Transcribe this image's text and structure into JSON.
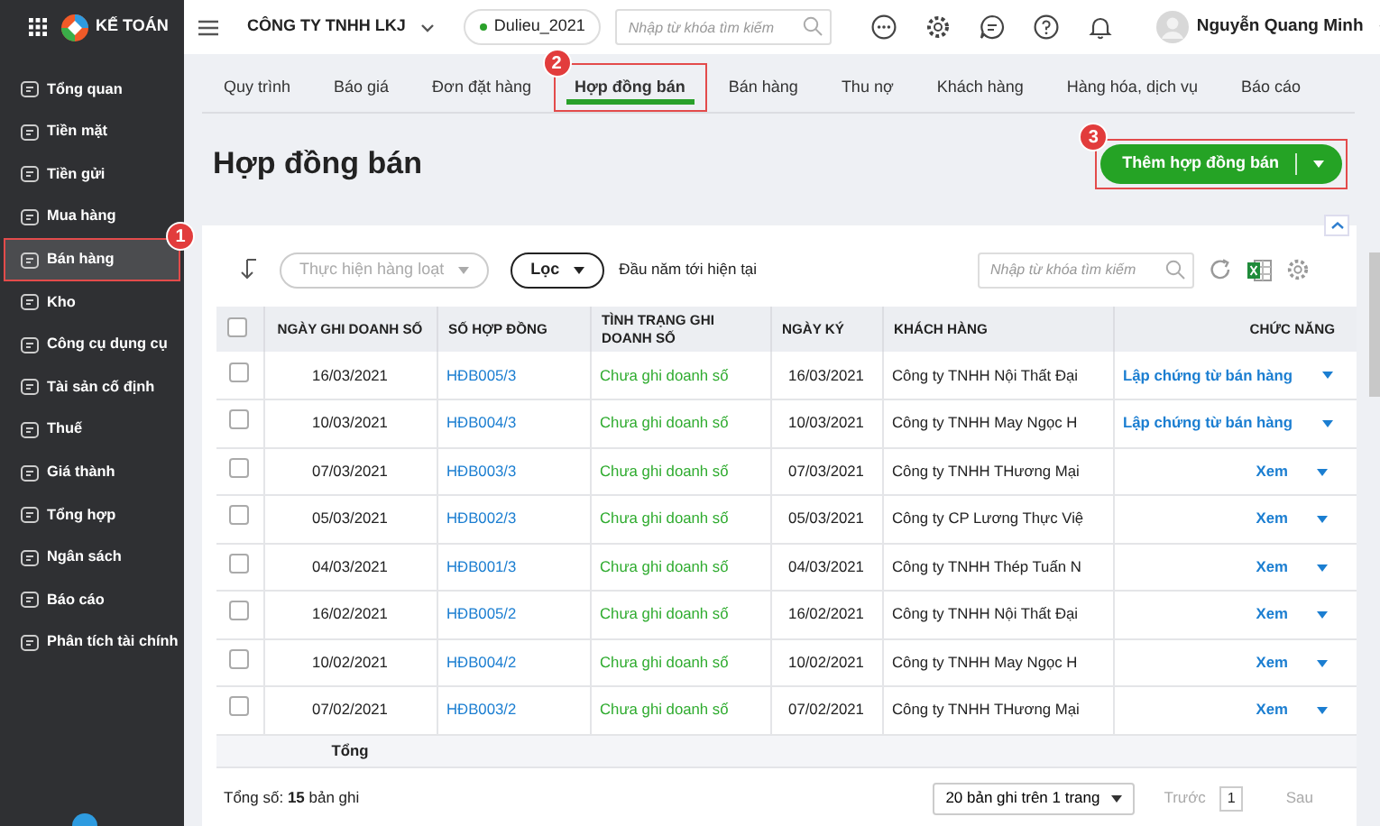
{
  "app": {
    "name": "KẾ TOÁN"
  },
  "header": {
    "company": "CÔNG TY TNHH LKJ",
    "database": "Dulieu_2021",
    "search_placeholder": "Nhập từ khóa tìm kiếm",
    "user": "Nguyễn Quang Minh"
  },
  "sidebar": {
    "items": [
      {
        "label": "Tổng quan",
        "selected": false
      },
      {
        "label": "Tiền mặt",
        "selected": false
      },
      {
        "label": "Tiền gửi",
        "selected": false
      },
      {
        "label": "Mua hàng",
        "selected": false
      },
      {
        "label": "Bán hàng",
        "selected": true,
        "callout": "1"
      },
      {
        "label": "Kho",
        "selected": false
      },
      {
        "label": "Công cụ dụng cụ",
        "selected": false
      },
      {
        "label": "Tài sản cố định",
        "selected": false
      },
      {
        "label": "Thuế",
        "selected": false
      },
      {
        "label": "Giá thành",
        "selected": false
      },
      {
        "label": "Tổng hợp",
        "selected": false
      },
      {
        "label": "Ngân sách",
        "selected": false
      },
      {
        "label": "Báo cáo",
        "selected": false
      },
      {
        "label": "Phân tích tài chính",
        "selected": false
      }
    ]
  },
  "tabs": [
    {
      "label": "Quy trình",
      "selected": false
    },
    {
      "label": "Báo giá",
      "selected": false
    },
    {
      "label": "Đơn đặt hàng",
      "selected": false
    },
    {
      "label": "Hợp đồng bán",
      "selected": true,
      "callout": "2"
    },
    {
      "label": "Bán hàng",
      "selected": false
    },
    {
      "label": "Thu nợ",
      "selected": false
    },
    {
      "label": "Khách hàng",
      "selected": false
    },
    {
      "label": "Hàng hóa, dịch vụ",
      "selected": false
    },
    {
      "label": "Báo cáo",
      "selected": false
    }
  ],
  "page_title": "Hợp đồng bán",
  "add_button": {
    "label": "Thêm hợp đồng bán",
    "callout": "3"
  },
  "toolbar": {
    "bulk_action": {
      "label": "Thực hiện hàng loạt",
      "disabled": true
    },
    "filter": "Lọc",
    "period": "Đầu năm tới hiện tại",
    "search_placeholder": "Nhập từ khóa tìm kiếm"
  },
  "table": {
    "select_all_checked": false,
    "columns": [
      "NGÀY GHI DOANH SỐ",
      "SỐ HỢP ĐỒNG",
      "TÌNH TRẠNG GHI DOANH SỐ",
      "NGÀY KÝ",
      "KHÁCH HÀNG",
      "CHỨC NĂNG"
    ],
    "rows": [
      {
        "checked": false,
        "sales_date": "16/03/2021",
        "contract_no": "HĐB005/3",
        "status": "Chưa ghi doanh số",
        "sign_date": "16/03/2021",
        "customer": "Công ty TNHH Nội Thất Đại",
        "action": "Lập chứng từ bán hàng"
      },
      {
        "checked": false,
        "sales_date": "10/03/2021",
        "contract_no": "HĐB004/3",
        "status": "Chưa ghi doanh số",
        "sign_date": "10/03/2021",
        "customer": "Công ty TNHH May Ngọc H",
        "action": "Lập chứng từ bán hàng"
      },
      {
        "checked": false,
        "sales_date": "07/03/2021",
        "contract_no": "HĐB003/3",
        "status": "Chưa ghi doanh số",
        "sign_date": "07/03/2021",
        "customer": "Công ty TNHH THương Mại",
        "action": "Xem"
      },
      {
        "checked": false,
        "sales_date": "05/03/2021",
        "contract_no": "HĐB002/3",
        "status": "Chưa ghi doanh số",
        "sign_date": "05/03/2021",
        "customer": "Công ty CP Lương Thực Việ",
        "action": "Xem"
      },
      {
        "checked": false,
        "sales_date": "04/03/2021",
        "contract_no": "HĐB001/3",
        "status": "Chưa ghi doanh số",
        "sign_date": "04/03/2021",
        "customer": "Công ty TNHH Thép Tuấn N",
        "action": "Xem"
      },
      {
        "checked": false,
        "sales_date": "16/02/2021",
        "contract_no": "HĐB005/2",
        "status": "Chưa ghi doanh số",
        "sign_date": "16/02/2021",
        "customer": "Công ty TNHH Nội Thất Đại",
        "action": "Xem"
      },
      {
        "checked": false,
        "sales_date": "10/02/2021",
        "contract_no": "HĐB004/2",
        "status": "Chưa ghi doanh số",
        "sign_date": "10/02/2021",
        "customer": "Công ty TNHH May Ngọc H",
        "action": "Xem"
      },
      {
        "checked": false,
        "sales_date": "07/02/2021",
        "contract_no": "HĐB003/2",
        "status": "Chưa ghi doanh số",
        "sign_date": "07/02/2021",
        "customer": "Công ty TNHH THương Mại",
        "action": "Xem"
      }
    ],
    "total_label": "Tổng"
  },
  "footer": {
    "total": "Tổng số: **15** bản ghi",
    "page_size": "20 bản ghi trên 1 trang",
    "prev": {
      "label": "Trước",
      "disabled": true
    },
    "page": "1",
    "next": {
      "label": "Sau",
      "disabled": true
    }
  }
}
